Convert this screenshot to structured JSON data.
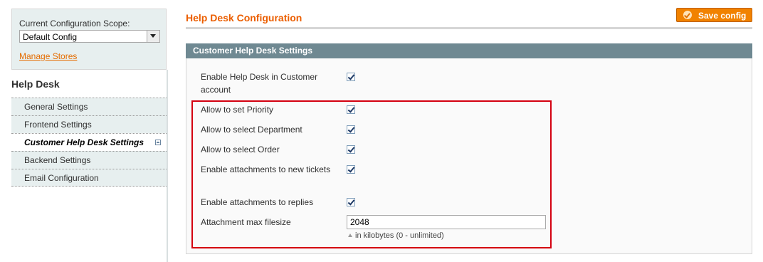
{
  "scope": {
    "label": "Current Configuration Scope:",
    "selected": "Default Config",
    "manage_link": "Manage Stores"
  },
  "sidebar": {
    "title": "Help Desk",
    "items": [
      {
        "label": "General Settings",
        "state": "normal"
      },
      {
        "label": "Frontend Settings",
        "state": "normal"
      },
      {
        "label": "Customer Help Desk Settings",
        "state": "active"
      },
      {
        "label": "Backend Settings",
        "state": "normal"
      },
      {
        "label": "Email Configuration",
        "state": "normal"
      }
    ]
  },
  "header": {
    "title": "Help Desk Configuration",
    "save_label": "Save config"
  },
  "section": {
    "title": "Customer Help Desk Settings",
    "fields": [
      {
        "label": "Enable Help Desk in Customer account",
        "checked": true
      },
      {
        "label": "Allow to set Priority",
        "checked": true
      },
      {
        "label": "Allow to select Department",
        "checked": true
      },
      {
        "label": "Allow to select Order",
        "checked": true
      },
      {
        "label": "Enable attachments to new tickets",
        "checked": true
      },
      {
        "label": "Enable attachments to replies",
        "checked": true
      }
    ],
    "filesize": {
      "label": "Attachment max filesize",
      "value": "2048",
      "note": "in kilobytes (0 - unlimited)"
    }
  },
  "colors": {
    "accent": "#eb5e00",
    "button": "#f18200",
    "section_header": "#6f8992",
    "highlight": "#d40010"
  }
}
